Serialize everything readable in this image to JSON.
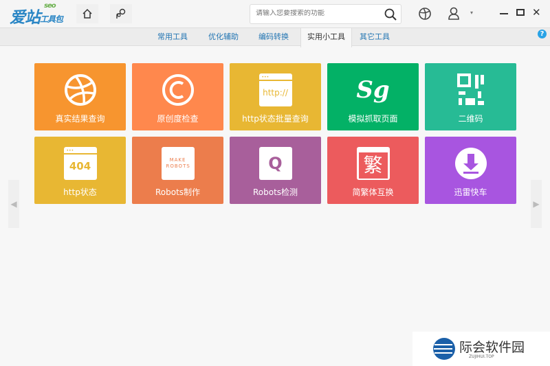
{
  "app": {
    "logo": "爱站",
    "logo_sub": "工具包",
    "logo_seo": "seo"
  },
  "search": {
    "placeholder": "请输入您要搜索的功能"
  },
  "tabs": [
    {
      "label": "常用工具"
    },
    {
      "label": "优化辅助"
    },
    {
      "label": "编码转换"
    },
    {
      "label": "实用小工具",
      "active": true
    },
    {
      "label": "其它工具"
    }
  ],
  "help": "?",
  "tiles": [
    {
      "label": "真实结果查询",
      "color": "#F7952F",
      "icon": "dribbble-icon"
    },
    {
      "label": "原创度检查",
      "color": "#FF884D",
      "icon": "copyright-icon"
    },
    {
      "label": "http状态批量查询",
      "color": "#E8B733",
      "icon": "browser-http-icon",
      "icon_text": "http://"
    },
    {
      "label": "模拟抓取页面",
      "color": "#03B166",
      "icon": "sg-logo-icon",
      "icon_text": "Sg"
    },
    {
      "label": "二维码",
      "color": "#27BB95",
      "icon": "qrcode-icon"
    },
    {
      "label": "http状态",
      "color": "#E8B733",
      "icon": "http-404-icon",
      "icon_text": "404"
    },
    {
      "label": "Robots制作",
      "color": "#EC7D4C",
      "icon": "make-robots-icon",
      "icon_text": "MAKE ROBOTS"
    },
    {
      "label": "Robots检测",
      "color": "#A85F9B",
      "icon": "robots-check-icon",
      "icon_text": "Q"
    },
    {
      "label": "简繁体互换",
      "color": "#EC5B5D",
      "icon": "traditional-char-icon",
      "icon_text": "繁"
    },
    {
      "label": "迅雷快车",
      "color": "#A855E0",
      "icon": "download-icon"
    }
  ],
  "watermark": {
    "name": "际会软件园",
    "domain": "ZUJIHUI.TOP"
  }
}
